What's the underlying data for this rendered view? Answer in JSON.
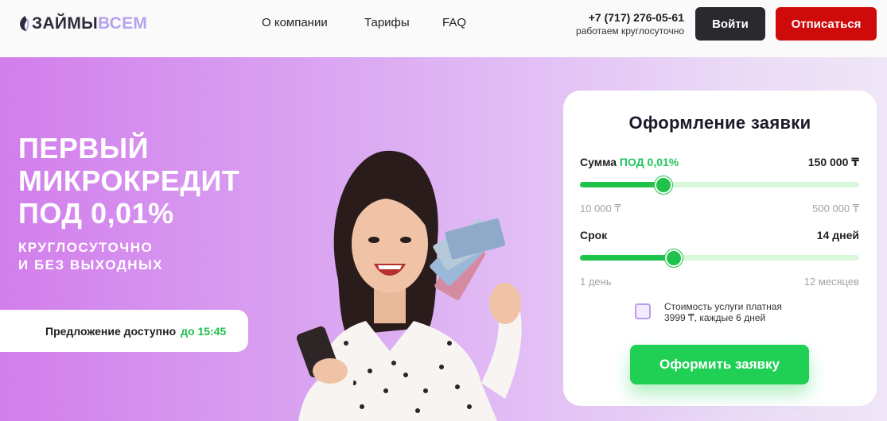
{
  "header": {
    "logo_part1": "ЗАЙМЫ",
    "logo_part2": "ВСЕМ",
    "nav": [
      "О компании",
      "Тарифы",
      "FAQ"
    ],
    "phone": "+7 (717) 276-05-61",
    "phone_note": "работаем круглосуточно",
    "login_label": "Войти",
    "unsubscribe_label": "Отписаться"
  },
  "hero": {
    "title_line1": "ПЕРВЫЙ",
    "title_line2": "МИКРОКРЕДИТ",
    "title_line3": "ПОД 0,01%",
    "subtitle_line1": "КРУГЛОСУТОЧНО",
    "subtitle_line2": "И БЕЗ ВЫХОДНЫХ",
    "offer_text": "Предложение доступно",
    "offer_time": "до 15:45"
  },
  "form": {
    "title": "Оформление заявки",
    "amount_label": "Сумма",
    "amount_rate": "ПОД 0,01%",
    "amount_value": "150 000 ₸",
    "amount_min": "10 000 ₸",
    "amount_max": "500 000 ₸",
    "amount_fraction": 0.3,
    "term_label": "Срок",
    "term_value": "14 дней",
    "term_min": "1 день",
    "term_max": "12 месяцев",
    "term_fraction": 0.335,
    "checkbox_line1": "Стоимость услуги платная",
    "checkbox_line2": "3999 ₸, каждые 6 дней",
    "submit_label": "Оформить заявку"
  },
  "colors": {
    "accent_green": "#1fc24a",
    "danger_red": "#cf0a0a",
    "dark_button": "#2a2a2e",
    "hero_purple": "#d27eec"
  }
}
